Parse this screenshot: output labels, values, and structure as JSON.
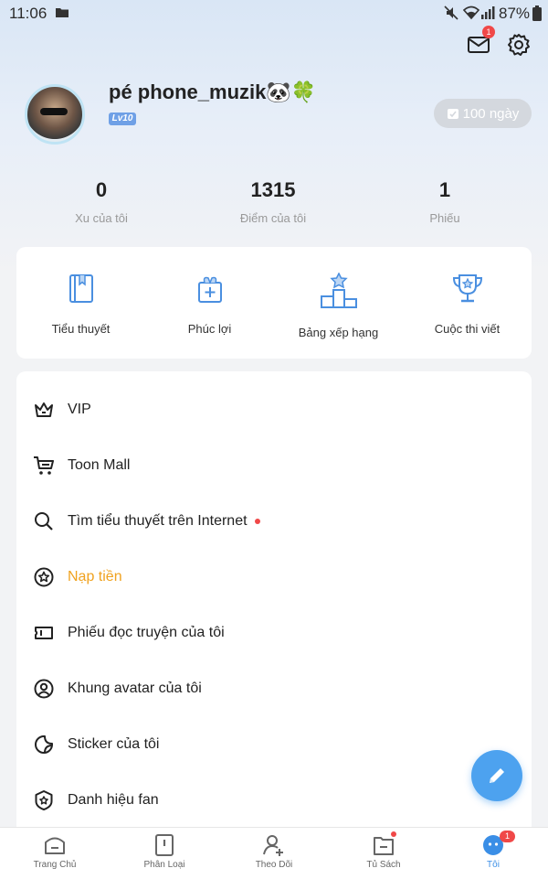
{
  "status_bar": {
    "time": "11:06",
    "battery": "87%"
  },
  "header": {
    "mail_badge": "1"
  },
  "profile": {
    "username": "pé phone_muzik🐼🍀",
    "level": "Lv10",
    "days": "100 ngày"
  },
  "stats": [
    {
      "value": "0",
      "label": "Xu của tôi"
    },
    {
      "value": "1315",
      "label": "Điểm của tôi"
    },
    {
      "value": "1",
      "label": "Phiếu"
    }
  ],
  "quick_links": [
    {
      "label": "Tiểu thuyết",
      "icon": "book-icon"
    },
    {
      "label": "Phúc lợi",
      "icon": "gift-icon"
    },
    {
      "label": "Bảng xếp hạng",
      "icon": "podium-icon"
    },
    {
      "label": "Cuộc thi viết",
      "icon": "trophy-icon"
    }
  ],
  "menu": [
    {
      "label": "VIP",
      "icon": "crown-icon"
    },
    {
      "label": "Toon Mall",
      "icon": "cart-icon"
    },
    {
      "label": "Tìm tiểu thuyết trên Internet",
      "icon": "search-icon"
    },
    {
      "label": "Nạp tiền",
      "icon": "coin-star-icon"
    },
    {
      "label": "Phiếu đọc truyện của tôi",
      "icon": "ticket-icon"
    },
    {
      "label": "Khung avatar của tôi",
      "icon": "avatar-frame-icon"
    },
    {
      "label": "Sticker của tôi",
      "icon": "sticker-icon"
    },
    {
      "label": "Danh hiệu fan",
      "icon": "badge-star-icon"
    }
  ],
  "colors": {
    "accent": "#f0a21f",
    "primary": "#4da2ef",
    "badge": "#f04848"
  },
  "bottom_nav": [
    {
      "label": "Trang Chủ"
    },
    {
      "label": "Phân Loại"
    },
    {
      "label": "Theo Dõi"
    },
    {
      "label": "Tủ Sách"
    },
    {
      "label": "Tôi"
    }
  ],
  "nav_badge": "1"
}
